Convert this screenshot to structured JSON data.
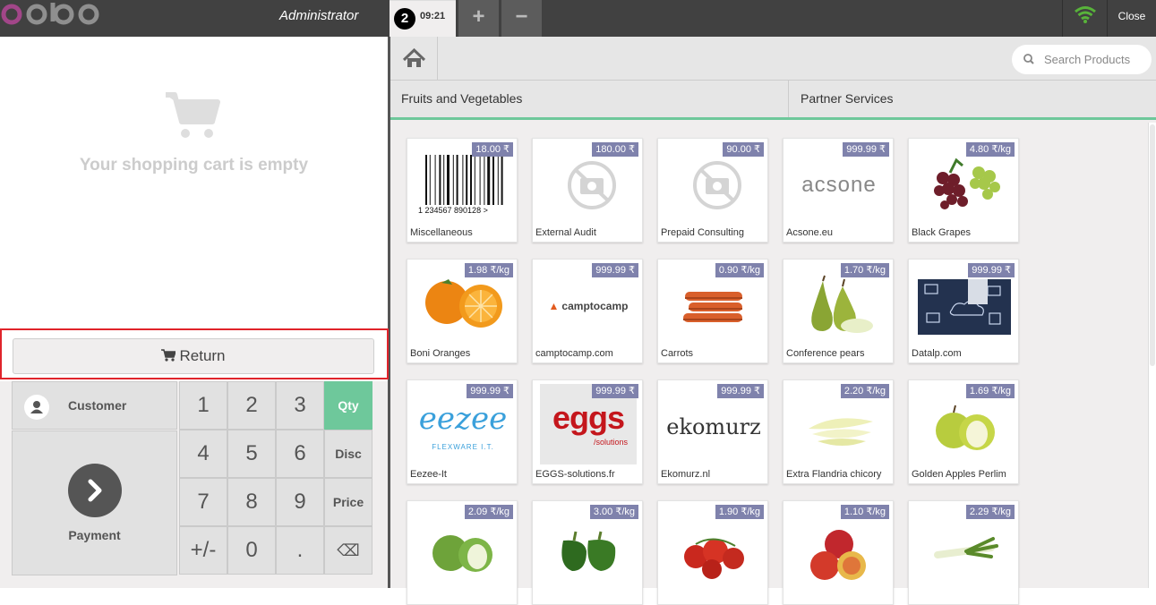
{
  "header": {
    "user": "Administrator",
    "order_number": "2",
    "order_time": "09:21",
    "add_order": "+",
    "remove_order": "−",
    "close": "Close"
  },
  "cart": {
    "empty_text": "Your shopping cart is empty"
  },
  "actions": {
    "return_label": "Return"
  },
  "pad": {
    "customer_label": "Customer",
    "payment_label": "Payment",
    "keys": [
      "1",
      "2",
      "3",
      "4",
      "5",
      "6",
      "7",
      "8",
      "9",
      "+/-",
      "0",
      "."
    ],
    "modes": [
      "Qty",
      "Disc",
      "Price"
    ],
    "backspace": "⌫"
  },
  "search": {
    "placeholder": "Search Products"
  },
  "categories": [
    "Fruits and Vegetables",
    "Partner Services"
  ],
  "products": [
    {
      "name": "Miscellaneous",
      "price": "18.00 ₹",
      "image": "barcode",
      "barcode_text": "1  234567  890128  >"
    },
    {
      "name": "External Audit",
      "price": "180.00 ₹",
      "image": "no-photo"
    },
    {
      "name": "Prepaid Consulting",
      "price": "90.00 ₹",
      "image": "no-photo"
    },
    {
      "name": "Acsone.eu",
      "price": "999.99 ₹",
      "image": "logo-acsone",
      "logo_text": "acsone"
    },
    {
      "name": "Black Grapes",
      "price": "4.80 ₹/kg",
      "image": "grapes"
    },
    {
      "name": "Boni Oranges",
      "price": "1.98 ₹/kg",
      "image": "oranges"
    },
    {
      "name": "camptocamp.com",
      "price": "999.99 ₹",
      "image": "logo-camptocamp",
      "logo_text": "camptocamp"
    },
    {
      "name": "Carrots",
      "price": "0.90 ₹/kg",
      "image": "carrots"
    },
    {
      "name": "Conference pears",
      "price": "1.70 ₹/kg",
      "image": "pears"
    },
    {
      "name": "Datalp.com",
      "price": "999.99 ₹",
      "image": "datalp"
    },
    {
      "name": "Eezee-It",
      "price": "999.99 ₹",
      "image": "logo-eezee",
      "logo_text": "eezee",
      "logo_sub": "FLEXWARE I.T."
    },
    {
      "name": "EGGS-solutions.fr",
      "price": "999.99 ₹",
      "image": "logo-eggs",
      "logo_text": "eggs",
      "logo_sub": "/solutions"
    },
    {
      "name": "Ekomurz.nl",
      "price": "999.99 ₹",
      "image": "logo-ekomurz",
      "logo_text": "ekomurz"
    },
    {
      "name": "Extra Flandria chicory",
      "price": "2.20 ₹/kg",
      "image": "chicory"
    },
    {
      "name": "Golden Apples Perlim",
      "price": "1.69 ₹/kg",
      "image": "golden-apples"
    },
    {
      "name": "",
      "price": "2.09 ₹/kg",
      "image": "green-apples"
    },
    {
      "name": "",
      "price": "3.00 ₹/kg",
      "image": "green-peppers"
    },
    {
      "name": "",
      "price": "1.90 ₹/kg",
      "image": "tomatoes"
    },
    {
      "name": "",
      "price": "1.10 ₹/kg",
      "image": "red-apples"
    },
    {
      "name": "",
      "price": "2.29 ₹/kg",
      "image": "leek"
    }
  ],
  "colors": {
    "accent": "#6ec89b",
    "price_badge": "#7f82ac",
    "topbar": "#414141",
    "return_highlight": "#e0242b"
  }
}
